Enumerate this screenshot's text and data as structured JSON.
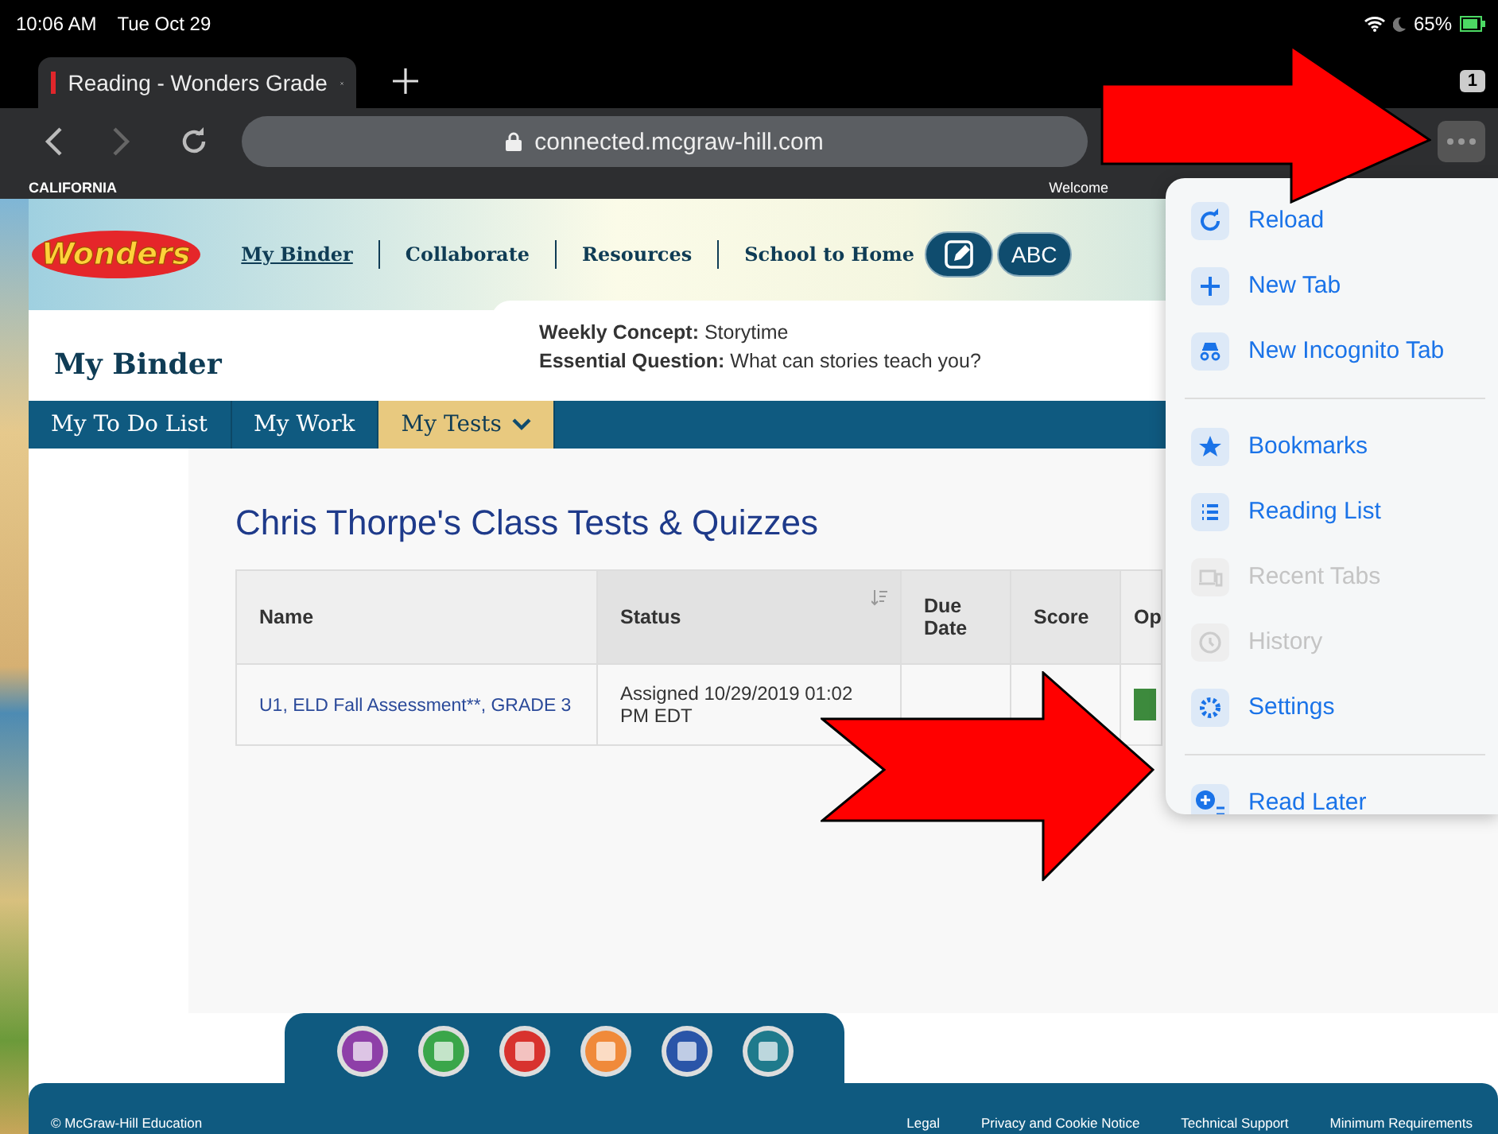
{
  "status_bar": {
    "time": "10:06 AM",
    "date": "Tue Oct 29",
    "battery": "65%"
  },
  "browser": {
    "tab_title": "Reading - Wonders Grade",
    "tab_count": "1",
    "url": "connected.mcgraw-hill.com"
  },
  "site": {
    "region": "CALIFORNIA",
    "welcome": "Welcome",
    "logo": "Wonders",
    "nav": [
      {
        "label": "My Binder",
        "selected": true
      },
      {
        "label": "Collaborate",
        "selected": false
      },
      {
        "label": "Resources",
        "selected": false
      },
      {
        "label": "School to Home",
        "selected": false
      }
    ],
    "abc_button": "ABC",
    "page_title": "My Binder",
    "concept": [
      "**Weekly Concept:** Storytime",
      "**Essential Question:** What can stories teach you?"
    ],
    "tabs": [
      {
        "label": "My To Do List",
        "selected": false
      },
      {
        "label": "My Work",
        "selected": false
      },
      {
        "label": "My Tests",
        "selected": true
      }
    ],
    "heading": "Chris Thorpe's Class Tests & Quizzes",
    "table": {
      "columns": [
        "Name",
        "Status",
        "Due Date",
        "Score",
        "Op"
      ],
      "rows": [
        [
          "U1, ELD Fall Assessment**, GRADE 3",
          "Assigned 10/29/2019 01:02 PM EDT"
        ]
      ]
    },
    "footer": {
      "copyright": "© McGraw-Hill Education",
      "links": [
        "Legal",
        "Privacy and Cookie Notice",
        "Technical Support",
        "Minimum Requirements"
      ]
    }
  },
  "menu": [
    {
      "kind": "item",
      "label": "Reload",
      "disabled": false
    },
    {
      "kind": "item",
      "label": "New Tab",
      "disabled": false
    },
    {
      "kind": "item",
      "label": "New Incognito Tab",
      "disabled": false
    },
    {
      "kind": "separator"
    },
    {
      "kind": "item",
      "label": "Bookmarks",
      "disabled": false
    },
    {
      "kind": "item",
      "label": "Reading List",
      "disabled": false
    },
    {
      "kind": "item",
      "label": "Recent Tabs",
      "disabled": true
    },
    {
      "kind": "item",
      "label": "History",
      "disabled": true
    },
    {
      "kind": "item",
      "label": "Settings",
      "disabled": false
    },
    {
      "kind": "separator"
    },
    {
      "kind": "item",
      "label": "Read Later",
      "disabled": false
    }
  ]
}
